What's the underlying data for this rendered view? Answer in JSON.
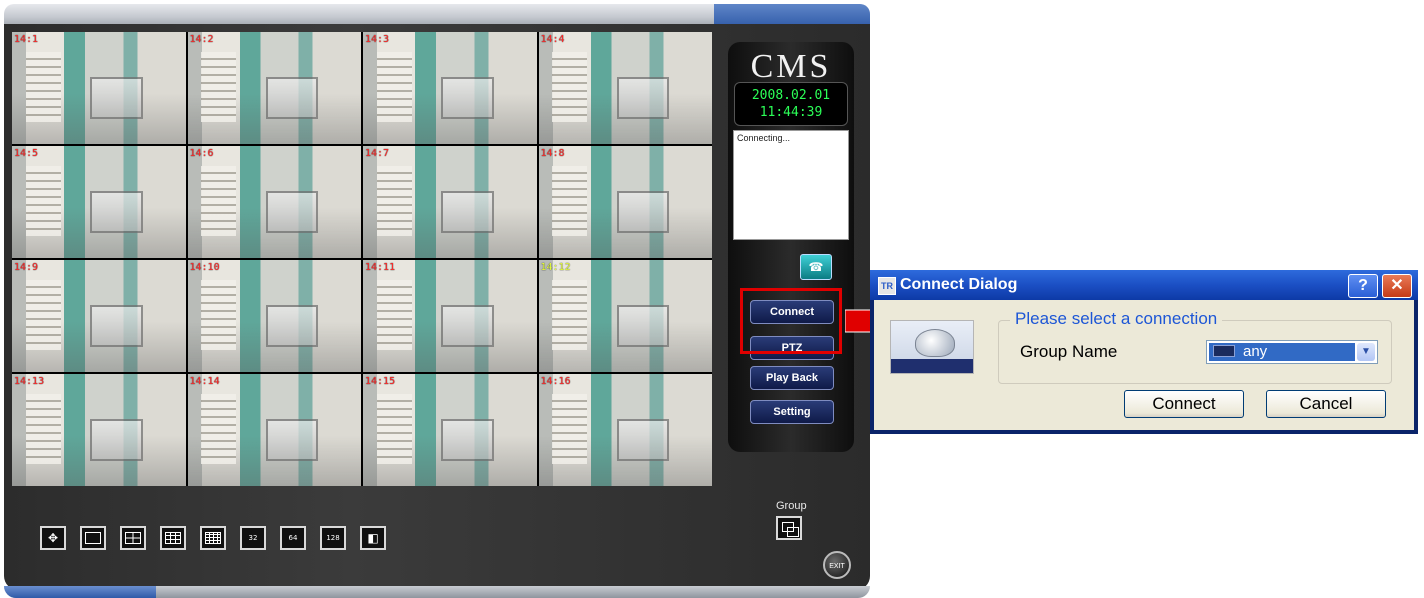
{
  "cms": {
    "logo": "CMS",
    "clock_date": "2008.02.01",
    "clock_time": "11:44:39",
    "log_text": "Connecting...",
    "cameras": [
      {
        "label": "14:1",
        "color": "red"
      },
      {
        "label": "14:2",
        "color": "red"
      },
      {
        "label": "14:3",
        "color": "red"
      },
      {
        "label": "14:4",
        "color": "red"
      },
      {
        "label": "14:5",
        "color": "red"
      },
      {
        "label": "14:6",
        "color": "red"
      },
      {
        "label": "14:7",
        "color": "red"
      },
      {
        "label": "14:8",
        "color": "red"
      },
      {
        "label": "14:9",
        "color": "red"
      },
      {
        "label": "14:10",
        "color": "red"
      },
      {
        "label": "14:11",
        "color": "red"
      },
      {
        "label": "14:12",
        "color": "yellow"
      },
      {
        "label": "14:13",
        "color": "red"
      },
      {
        "label": "14:14",
        "color": "red"
      },
      {
        "label": "14:15",
        "color": "red"
      },
      {
        "label": "14:16",
        "color": "red"
      }
    ],
    "buttons": {
      "connect": "Connect",
      "ptz": "PTZ",
      "playback": "Play Back",
      "setting": "Setting"
    },
    "layout_labels": {
      "l32": "32",
      "l64": "64",
      "l128": "128"
    },
    "group_label": "Group",
    "exit_label": "EXIT",
    "highlight_color": "#e00000"
  },
  "dialog": {
    "title": "Connect Dialog",
    "icon_text": "TR",
    "help": "?",
    "close": "✕",
    "legend": "Please select a connection",
    "group_name_label": "Group Name",
    "group_name_value": "any",
    "connect_button": "Connect",
    "cancel_button": "Cancel"
  }
}
